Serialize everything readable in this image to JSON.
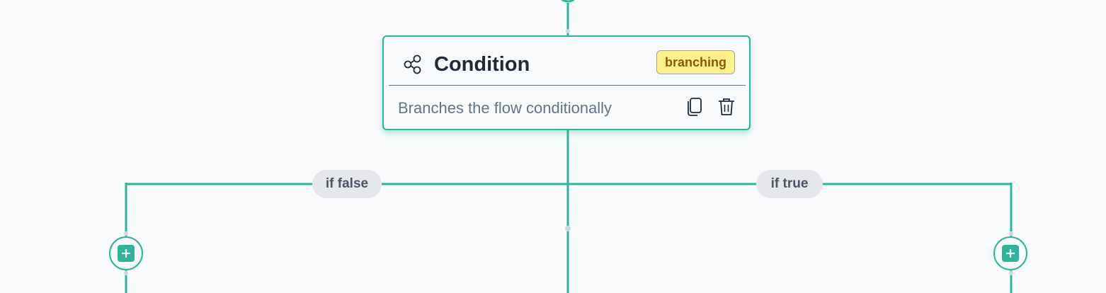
{
  "colors": {
    "edge": "#2bb59a",
    "card_border": "#2bb59a",
    "badge_bg": "#fef08a",
    "badge_text": "#8a5a0b",
    "label_bg": "#e5e7eb"
  },
  "node": {
    "icon": "share-nodes-icon",
    "title": "Condition",
    "badge": "branching",
    "description": "Branches the flow conditionally",
    "actions": [
      {
        "name": "duplicate",
        "icon": "copy-icon"
      },
      {
        "name": "delete",
        "icon": "trash-icon"
      }
    ]
  },
  "branches": [
    {
      "label": "if false",
      "add_icon": "plus-icon"
    },
    {
      "label": "if true",
      "add_icon": "plus-icon"
    }
  ]
}
